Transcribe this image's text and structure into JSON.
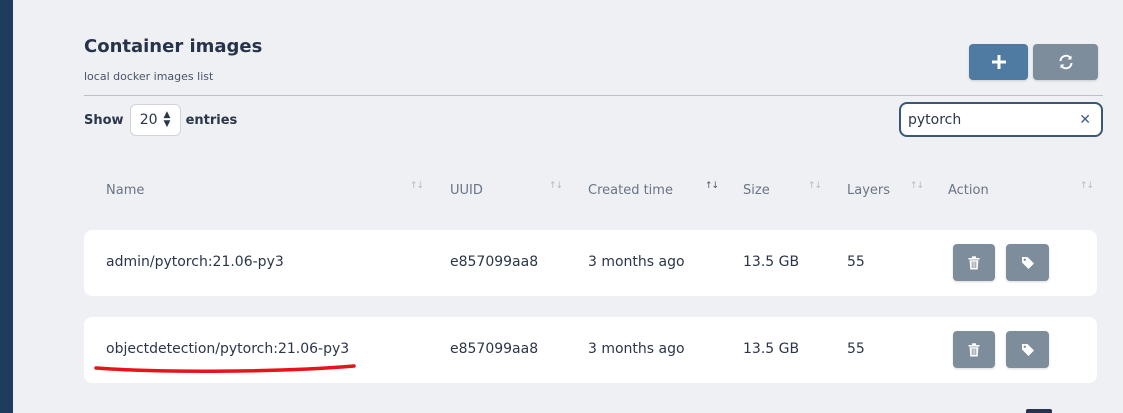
{
  "header": {
    "title": "Container images",
    "subtitle": "local docker images list"
  },
  "toolbar": {
    "add_icon": "plus-icon",
    "refresh_icon": "refresh-icon"
  },
  "list_controls": {
    "show_label": "Show",
    "page_size": "20",
    "entries_label": "entries"
  },
  "search": {
    "value": "pytorch",
    "clear_icon": "close-icon"
  },
  "table": {
    "columns": [
      {
        "label": "Name",
        "sort": "none"
      },
      {
        "label": "UUID",
        "sort": "none"
      },
      {
        "label": "Created time",
        "sort": "descending"
      },
      {
        "label": "Size",
        "sort": "none"
      },
      {
        "label": "Layers",
        "sort": "none"
      },
      {
        "label": "Action",
        "sort": "none"
      }
    ],
    "rows": [
      {
        "name": "admin/pytorch:21.06-py3",
        "uuid": "e857099aa8",
        "created": "3 months ago",
        "size": "13.5 GB",
        "layers": "55"
      },
      {
        "name": "objectdetection/pytorch:21.06-py3",
        "uuid": "e857099aa8",
        "created": "3 months ago",
        "size": "13.5 GB",
        "layers": "55",
        "highlighted": true
      }
    ],
    "row_actions": [
      "trash-icon",
      "tag-icon"
    ]
  },
  "colors": {
    "sidebar": "#1f3b5e",
    "primary_button": "#4f7aa1",
    "secondary_button": "#7d8d9c",
    "highlight_annotation": "#e8121b"
  }
}
